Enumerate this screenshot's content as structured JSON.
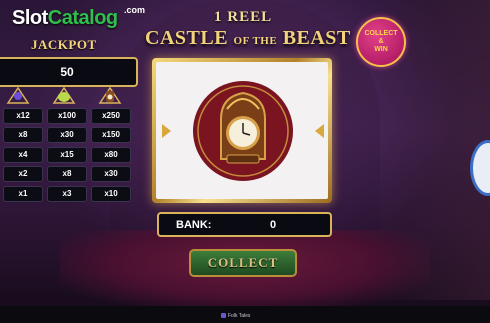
{
  "logo": {
    "slot": "Slot",
    "catalog": "Catalog",
    "com": ".com"
  },
  "jackpot": {
    "title": "JACKPOT",
    "value": "50"
  },
  "title": {
    "reels": "1 REEL",
    "castle": "CASTLE",
    "of_the": "OF THE",
    "beast": "BEAST"
  },
  "badge": {
    "line1": "COLLECT",
    "line2": "&",
    "line3": "WIN"
  },
  "paytable": {
    "icons": [
      "rose-icon",
      "teapot-icon",
      "clock-icon"
    ],
    "rows": [
      [
        "x12",
        "x100",
        "x250"
      ],
      [
        "x8",
        "x30",
        "x150"
      ],
      [
        "x4",
        "x15",
        "x80"
      ],
      [
        "x2",
        "x8",
        "x30"
      ],
      [
        "x1",
        "x3",
        "x10"
      ]
    ]
  },
  "reel": {
    "symbol": "clock-icon"
  },
  "bank": {
    "label": "BANK:",
    "value": "0"
  },
  "collect": {
    "label": "COLLECT"
  },
  "footer": {
    "text": "Folk Tales"
  },
  "colors": {
    "gold": "#d9b35a",
    "badge": "#c21c6e",
    "button": "#2f6b2f"
  }
}
